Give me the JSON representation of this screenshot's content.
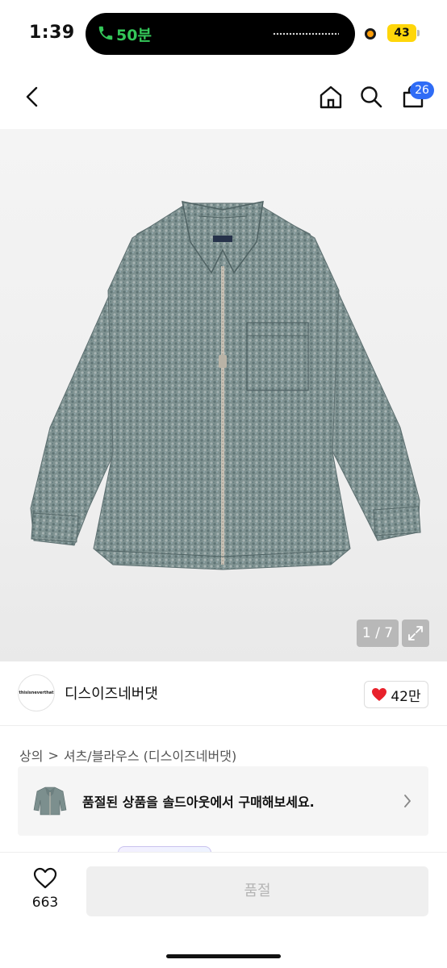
{
  "status_bar": {
    "time": "1:39",
    "call_duration": "50분",
    "battery": "43",
    "accent_call": "#34c759",
    "accent_battery": "#ffd60a"
  },
  "nav": {
    "back_icon": "chevron-left-icon",
    "home_icon": "home-icon",
    "search_icon": "search-icon",
    "cart_icon": "cart-icon",
    "cart_count": "26",
    "badge_color": "#2f6cf6"
  },
  "gallery": {
    "counter": "1 / 7",
    "expand_icon": "expand-icon",
    "product_label": "thisisneverthat"
  },
  "brand": {
    "logo_text": "thisisneverthat",
    "name": "디스이즈네버댓",
    "like_count": "42만",
    "heart_color": "#e8212b"
  },
  "category": {
    "primary": "상의",
    "separator": ">",
    "secondary": "셔츠/블라우스 (디스이즈네버댓)"
  },
  "banner": {
    "text": "품절된 상품을 솔드아웃에서 구매해보세요."
  },
  "bottom": {
    "wish_count": "663",
    "buy_label": "품절"
  }
}
